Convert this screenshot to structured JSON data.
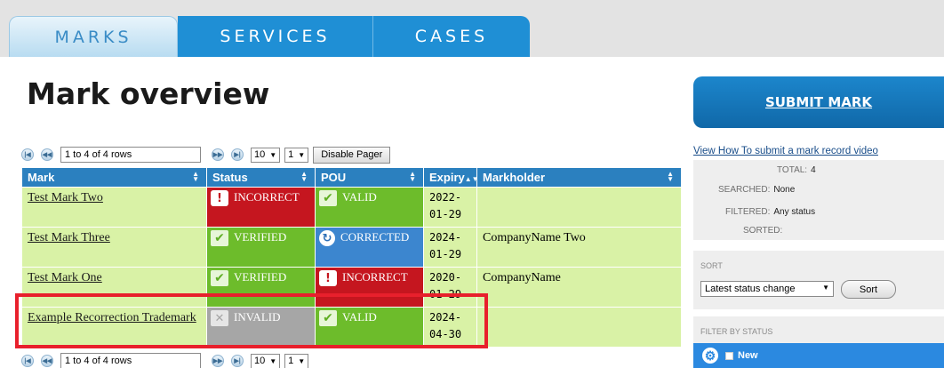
{
  "tabs": [
    {
      "label": "MARKS"
    },
    {
      "label": "SERVICES"
    },
    {
      "label": "CASES"
    }
  ],
  "page_title": "Mark overview",
  "pager": {
    "rows_text": "1 to 4 of 4 rows",
    "page_size": "10",
    "page_number": "1",
    "disable_label": "Disable Pager"
  },
  "table": {
    "headers": [
      "Mark",
      "Status",
      "POU",
      "Expiry",
      "Markholder"
    ],
    "rows": [
      {
        "mark": "Test Mark Two",
        "status": "INCORRECT",
        "pou": "VALID",
        "expiry_1": "2022-",
        "expiry_2": "01-29",
        "markholder": ""
      },
      {
        "mark": "Test Mark Three",
        "status": "VERIFIED",
        "pou": "CORRECTED",
        "expiry_1": "2024-",
        "expiry_2": "01-29",
        "markholder": "CompanyName Two"
      },
      {
        "mark": "Test Mark One",
        "status": "VERIFIED",
        "pou": "INCORRECT",
        "expiry_1": "2020-",
        "expiry_2": "01-29",
        "markholder": "CompanyName"
      },
      {
        "mark": "Example Recorrection Trademark",
        "status": "INVALID",
        "pou": "VALID",
        "expiry_1": "2024-",
        "expiry_2": "04-30",
        "markholder": ""
      }
    ]
  },
  "sidebar": {
    "submit_label": "SUBMIT MARK",
    "video_link": "View How To submit a mark record video",
    "stats": {
      "total_label": "TOTAL:",
      "total_value": "4",
      "searched_label": "SEARCHED:",
      "searched_value": "None",
      "filtered_label": "FILTERED:",
      "filtered_value": "Any status",
      "sorted_label": "SORTED:",
      "sorted_value": ""
    },
    "sort": {
      "heading": "SORT",
      "selected": "Latest status change",
      "button": "Sort"
    },
    "filter": {
      "heading": "FILTER BY STATUS",
      "item": "New"
    }
  },
  "colors": {
    "header_blue": "#2b80bf",
    "row_green": "#d9f2a6",
    "status_red": "#c5161f",
    "status_green": "#6dbc2b",
    "status_blue": "#3c86cf",
    "status_grey": "#a6a6a6",
    "highlight_red": "#e8202c"
  }
}
